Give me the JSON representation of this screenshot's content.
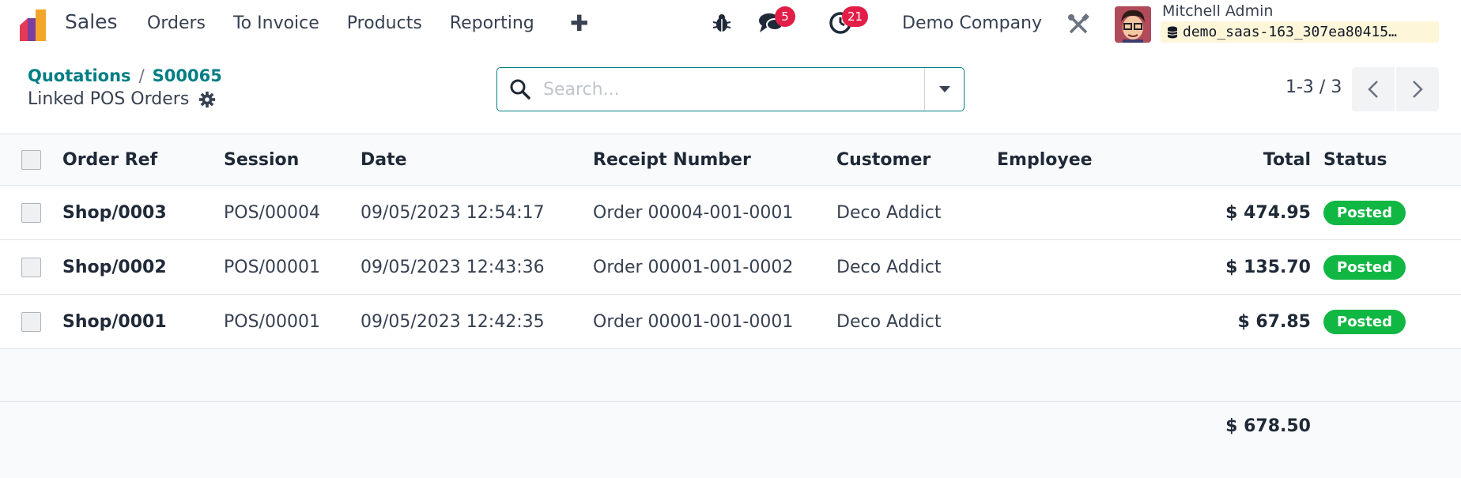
{
  "navbar": {
    "app_name": "Sales",
    "menu": [
      "Orders",
      "To Invoice",
      "Products",
      "Reporting"
    ],
    "messages_count": "5",
    "activities_count": "21",
    "company": "Demo Company",
    "user_name": "Mitchell Admin",
    "database": "demo_saas-163_307ea80415…",
    "icons": [
      "app-logo",
      "plus-icon",
      "bug-icon",
      "chat-icon",
      "clock-icon",
      "tools-icon",
      "database-icon"
    ]
  },
  "breadcrumb": {
    "parent": "Quotations",
    "separator": "/",
    "current": "S00065"
  },
  "page_title": "Linked POS Orders",
  "search": {
    "placeholder": "Search...",
    "value": ""
  },
  "pager": {
    "value": "1-3 / 3"
  },
  "table": {
    "columns": [
      "Order Ref",
      "Session",
      "Date",
      "Receipt Number",
      "Customer",
      "Employee",
      "Total",
      "Status"
    ],
    "rows": [
      {
        "ref": "Shop/0003",
        "session": "POS/00004",
        "date": "09/05/2023 12:54:17",
        "receipt": "Order 00004-001-0001",
        "customer": "Deco Addict",
        "employee": "",
        "total": "$ 474.95",
        "status": "Posted"
      },
      {
        "ref": "Shop/0002",
        "session": "POS/00001",
        "date": "09/05/2023 12:43:36",
        "receipt": "Order 00001-001-0002",
        "customer": "Deco Addict",
        "employee": "",
        "total": "$ 135.70",
        "status": "Posted"
      },
      {
        "ref": "Shop/0001",
        "session": "POS/00001",
        "date": "09/05/2023 12:42:35",
        "receipt": "Order 00001-001-0001",
        "customer": "Deco Addict",
        "employee": "",
        "total": "$ 67.85",
        "status": "Posted"
      }
    ],
    "grand_total": "$ 678.50"
  },
  "colors": {
    "accent": "#017e84",
    "badge": "#e11d48",
    "posted": "#10b743"
  }
}
